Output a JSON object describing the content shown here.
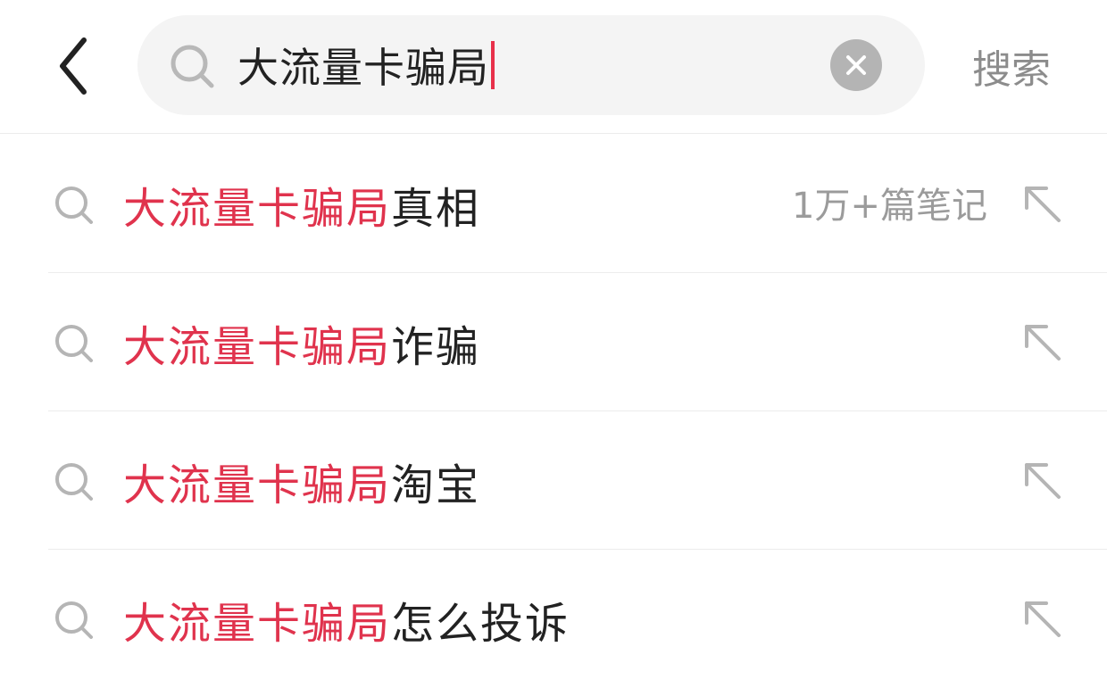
{
  "header": {
    "query": "大流量卡骗局",
    "search_label": "搜索"
  },
  "suggestions": [
    {
      "highlight": "大流量卡骗局",
      "rest": "真相",
      "count": "1万+篇笔记"
    },
    {
      "highlight": "大流量卡骗局",
      "rest": "诈骗",
      "count": ""
    },
    {
      "highlight": "大流量卡骗局",
      "rest": "淘宝",
      "count": ""
    },
    {
      "highlight": "大流量卡骗局",
      "rest": "怎么投诉",
      "count": ""
    }
  ],
  "colors": {
    "highlight": "#e0334d",
    "caret": "#e8304a",
    "text": "#222222",
    "muted": "#9b9b9b",
    "search_bg": "#f4f4f4"
  },
  "icons": {
    "back": "chevron-left-icon",
    "search": "search-icon",
    "clear": "clear-icon",
    "fill": "arrow-up-left-icon"
  }
}
